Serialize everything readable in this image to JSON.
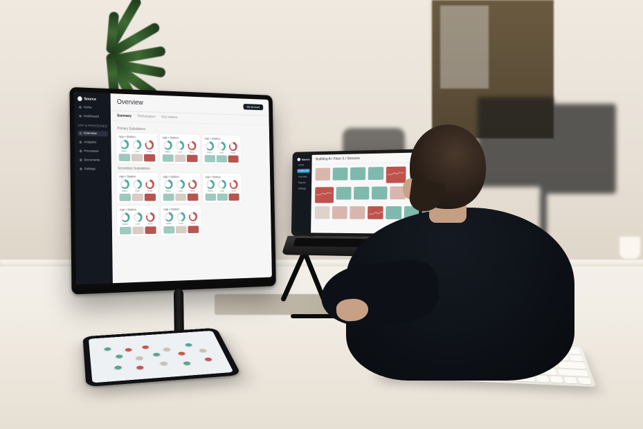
{
  "brand": "Source",
  "monitor": {
    "sidebar": {
      "section_label": "App & Processes",
      "items": [
        "Home",
        "Dashboard",
        "Overview",
        "Analytics",
        "Processes",
        "Documents",
        "Settings"
      ],
      "active_index": 2
    },
    "title": "Overview",
    "account_button": "My account",
    "tabs": [
      "Summary",
      "Performance",
      "Key metrics"
    ],
    "active_tab": 0,
    "section_a_label": "Primary Substations",
    "section_b_label": "Secondary Substations",
    "gauge_labels": [
      "Status",
      "Load",
      "Temp"
    ],
    "colors": {
      "accent": "#2196c4",
      "ok": "#7fb9ad",
      "warn": "#d8b6ae",
      "bad": "#c0524c"
    }
  },
  "laptop": {
    "sidebar_items": [
      "Home",
      "Dashboard",
      "Overview",
      "Reports",
      "Settings"
    ],
    "sidebar_active": 1,
    "breadcrumb": "Building A / Floor 3 / Sensors"
  },
  "tablet": {
    "view": "map"
  }
}
